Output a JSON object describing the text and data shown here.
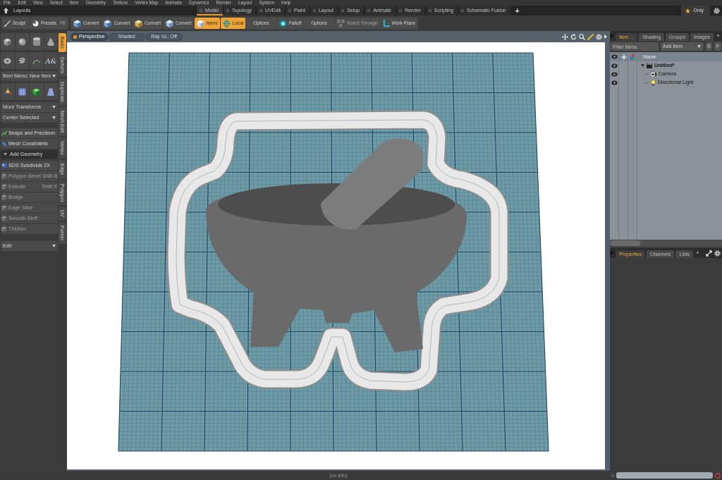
{
  "menu_bar": {
    "items": [
      "File",
      "Edit",
      "View",
      "Select",
      "Item",
      "Geometry",
      "Texture",
      "Vertex Map",
      "Animate",
      "Dynamics",
      "Render",
      "Layout",
      "System",
      "Help"
    ]
  },
  "layouts_bar": {
    "title": "Layouts",
    "tabs": [
      {
        "label": "Model",
        "selected": true
      },
      {
        "label": "Topology",
        "selected": false
      },
      {
        "label": "UVEdit",
        "selected": false
      },
      {
        "label": "Paint",
        "selected": false
      },
      {
        "label": "Layout",
        "selected": false
      },
      {
        "label": "Setup",
        "selected": false
      },
      {
        "label": "Animate",
        "selected": false
      },
      {
        "label": "Render",
        "selected": false
      },
      {
        "label": "Scripting",
        "selected": false
      },
      {
        "label": "Schematic Fusion",
        "selected": false
      }
    ],
    "add_label": "+",
    "only_label": "Only"
  },
  "toolbar": {
    "sculpt": {
      "label": "Sculpt"
    },
    "presets": {
      "label": "Presets",
      "shortcut": "F6"
    },
    "tools": [
      {
        "kind": "icon",
        "label": "Convert",
        "on": false,
        "disabled": false
      },
      {
        "kind": "icon",
        "label": "Convert",
        "on": false,
        "disabled": false
      },
      {
        "kind": "icon",
        "label": "Convert",
        "on": false,
        "disabled": false
      },
      {
        "kind": "icon",
        "label": "Convert",
        "on": false,
        "disabled": false
      },
      {
        "kind": "icon",
        "label": "Items",
        "on": true,
        "disabled": false
      },
      {
        "kind": "icon",
        "label": "Local",
        "on": true,
        "disabled": false
      },
      {
        "kind": "text",
        "label": "Options",
        "on": false,
        "disabled": false
      },
      {
        "kind": "icon",
        "label": "Falloff",
        "on": false,
        "disabled": false
      },
      {
        "kind": "text",
        "label": "Options",
        "on": false,
        "disabled": false
      },
      {
        "kind": "icon",
        "label": "Select Through",
        "on": false,
        "disabled": true
      },
      {
        "kind": "icon",
        "label": "Work Plane",
        "on": false,
        "disabled": false
      }
    ]
  },
  "tool_panel": {
    "text_glyph": "A&",
    "item_menu": "Item Menu: New Item",
    "transform_menus": [
      "More Transforms",
      "Center Selected"
    ],
    "constraint_tools": [
      "Snaps and Precision",
      "Mesh Constraints"
    ],
    "add_geometry": {
      "title": "Add Geometry",
      "expanded": true,
      "tools": [
        {
          "label": "SDS Subdivide 2X",
          "disabled": false
        },
        {
          "label": "Polygon Bevel",
          "shortcut": "Shift-B",
          "disabled": true
        },
        {
          "label": "Extrude",
          "shortcut": "Shift-X",
          "disabled": true
        },
        {
          "label": "Bridge",
          "disabled": true
        },
        {
          "label": "Edge Slice",
          "disabled": true
        },
        {
          "label": "Smooth Shift",
          "disabled": true
        },
        {
          "label": "Thicken",
          "disabled": true
        }
      ]
    },
    "edit_menu": "Edit"
  },
  "side_tabs": [
    {
      "label": "Basic",
      "selected": true
    },
    {
      "label": "Deform",
      "selected": false
    },
    {
      "label": "Duplicate",
      "selected": false
    },
    {
      "label": "Mesh Edit",
      "selected": false
    },
    {
      "label": "Vertex",
      "selected": false
    },
    {
      "label": "Edge",
      "selected": false
    },
    {
      "label": "Polygon",
      "selected": false
    },
    {
      "label": "UV",
      "selected": false
    },
    {
      "label": "Fusion",
      "selected": false
    }
  ],
  "viewport": {
    "view_buttons": [
      {
        "label": "Perspective",
        "active": true
      },
      {
        "label": "Shaded",
        "active": false
      },
      {
        "label": "Ray GL: Off",
        "active": false
      }
    ]
  },
  "item_list": {
    "tabs": [
      {
        "label": "Item ...",
        "selected": true
      },
      {
        "label": "Shading",
        "selected": false
      },
      {
        "label": "Groups",
        "selected": false
      },
      {
        "label": "Images",
        "selected": false
      }
    ],
    "add_label": "+",
    "filter": {
      "placeholder": "Filter Items"
    },
    "add_item": "Add Item",
    "buttons": [
      "S",
      "F"
    ],
    "columns": [
      "Name"
    ],
    "tree": [
      {
        "name": "Untitled*",
        "kind": "scene",
        "expanded": true,
        "children": [
          {
            "name": "Camera",
            "kind": "camera"
          },
          {
            "name": "Directional Light",
            "kind": "light"
          }
        ]
      }
    ]
  },
  "properties_panel": {
    "tabs": [
      {
        "label": "Properties",
        "selected": true
      },
      {
        "label": "Channels",
        "selected": false
      },
      {
        "label": "Lists",
        "selected": false
      }
    ],
    "add_label": "+"
  },
  "status_bar": {
    "message": "(no info)",
    "prompt": ">"
  }
}
